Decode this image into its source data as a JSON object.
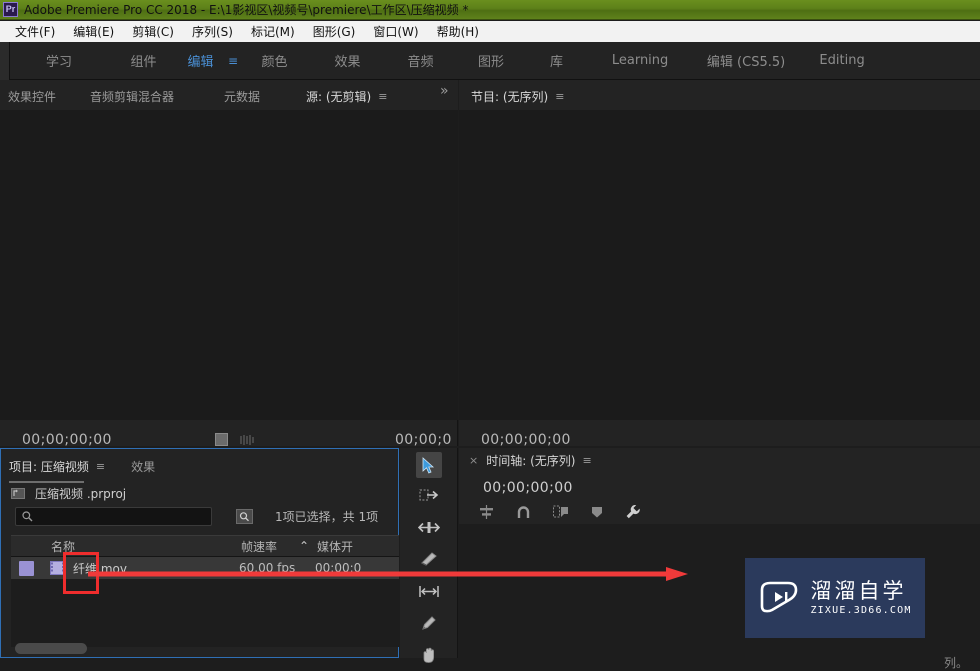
{
  "titlebar": {
    "app_badge": "Pr",
    "title": "Adobe Premiere Pro CC 2018 - E:\\1影视区\\视频号\\premiere\\工作区\\压缩视频 *"
  },
  "menubar": {
    "items": [
      {
        "label": "文件(F)"
      },
      {
        "label": "编辑(E)"
      },
      {
        "label": "剪辑(C)"
      },
      {
        "label": "序列(S)"
      },
      {
        "label": "标记(M)"
      },
      {
        "label": "图形(G)"
      },
      {
        "label": "窗口(W)"
      },
      {
        "label": "帮助(H)"
      }
    ]
  },
  "workspace": {
    "items": [
      {
        "label": "学习",
        "active": false
      },
      {
        "label": "组件",
        "active": false
      },
      {
        "label": "编辑",
        "active": true
      },
      {
        "label": "颜色",
        "active": false
      },
      {
        "label": "效果",
        "active": false
      },
      {
        "label": "音频",
        "active": false
      },
      {
        "label": "图形",
        "active": false
      },
      {
        "label": "库",
        "active": false
      },
      {
        "label": "Learning",
        "active": false
      },
      {
        "label": "编辑 (CS5.5)",
        "active": false
      },
      {
        "label": "Editing",
        "active": false
      }
    ],
    "menu_glyph": "≡"
  },
  "source_panel": {
    "tabs": [
      {
        "label": "效果控件",
        "active": false
      },
      {
        "label": "音频剪辑混合器",
        "active": false
      },
      {
        "label": "元数据",
        "active": false
      },
      {
        "label": "源: (无剪辑)",
        "active": true
      }
    ],
    "overflow_glyph": "»",
    "menu_glyph": "≡",
    "timecode_left": "00;00;00;00",
    "timecode_right": "00;00;0",
    "add_glyph": "+"
  },
  "program_panel": {
    "tab_label": "节目: (无序列)",
    "menu_glyph": "≡",
    "timecode": "00;00;00;00"
  },
  "project_panel": {
    "tabs": [
      {
        "label": "项目: 压缩视频",
        "active": true
      },
      {
        "label": "效果",
        "active": false
      }
    ],
    "menu_glyph": "≡",
    "project_file": "压缩视频 .prproj",
    "search_placeholder": "",
    "search_value": "",
    "selection_status": "1项已选择，共 1项",
    "columns": [
      {
        "label": "名称"
      },
      {
        "label": "帧速率"
      },
      {
        "label": "媒体开"
      }
    ],
    "sort_glyph": "⌃",
    "rows": [
      {
        "name": "纤维.mov",
        "frame_rate": "60.00 fps",
        "media_start": "00;00;0"
      }
    ]
  },
  "tools": {
    "items": [
      {
        "name": "selection-tool",
        "selected": true
      },
      {
        "name": "track-select-forward-tool",
        "selected": false
      },
      {
        "name": "ripple-edit-tool",
        "selected": false
      },
      {
        "name": "razor-tool",
        "selected": false
      },
      {
        "name": "slip-tool",
        "selected": false
      },
      {
        "name": "pen-tool",
        "selected": false
      },
      {
        "name": "hand-tool",
        "selected": false
      }
    ]
  },
  "timeline_panel": {
    "close_glyph": "×",
    "tab_label": "时间轴: (无序列)",
    "menu_glyph": "≡",
    "timecode": "00;00;00;00",
    "empty_message": "列。"
  },
  "watermark": {
    "cn_text": "溜溜自学",
    "en_text": "ZIXUE.3D66.COM",
    "bg_color": "#2b3a5c"
  },
  "annotations": {
    "highlight_color": "#ef2d2d",
    "arrow_color": "#f03a3a"
  },
  "theme": {
    "panel_bg": "#232323",
    "canvas_bg": "#1b1b1b",
    "accent_blue": "#2f6fb5",
    "active_tab_blue": "#4a8fd4",
    "title_green": "#5d8019"
  }
}
